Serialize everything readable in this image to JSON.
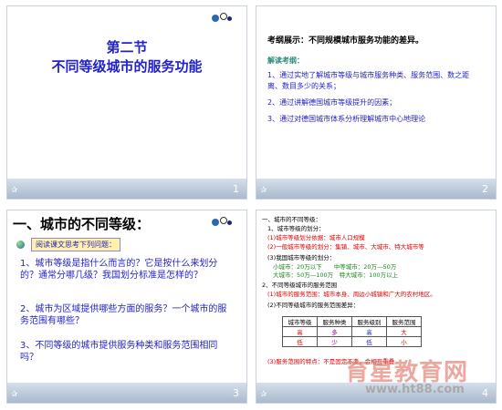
{
  "slides": [
    {
      "number": "1",
      "title_line1": "第二节",
      "title_line2": "不同等级城市的服务功能"
    },
    {
      "number": "2",
      "main": "考纲展示：不同规模城市服务功能的差异。",
      "subhead": "解读考纲：",
      "items": [
        "1、通过实地了解城市等级与城市服务种类、服务范围、数之距离、数目多少的关系；",
        "2、通过讲解德国城市等级提升的因素；",
        "3、通过对德国城市体系分析理解城市中心地理论"
      ]
    },
    {
      "number": "3",
      "heading": "一、城市的不同等级：",
      "note": "阅读课文思考下列问题：",
      "questions": [
        "1、城市等级是指什么而言的？它是按什么来划分的？通常分哪几级？我国划分标准是怎样的？",
        "2、城市为区域提供哪些方面的服务？一个城市的服务范围有哪些？",
        "3、不同等级的城市提供服务种类和服务范围相同吗？"
      ]
    },
    {
      "number": "4",
      "lines": [
        "一、城市的不同等级：",
        "1、城市等级的划分：",
        "(1)城市等级划分依据：城市人口规模",
        "(2)一般城市等级的划分：集镇、城市、大城市、特大城市等",
        "(3)我国城市等级的划分：",
        "小城市：20万以下　　中等城市：20万—50万",
        "大城市：50万—100万　特大城市：100万以上",
        "2、不同等级城市的服务范围",
        "(1)城市的服务范围：城市本身、周边小城镇和广大的农村地区。",
        "(2)不同等级城市的服务范围差异：",
        "(3)服务范围的特点：不是固定不变，会相互重叠。"
      ],
      "table_headers": [
        "城市等级",
        "服务种类",
        "服务级别",
        "服务范围"
      ],
      "table_rows": [
        [
          "高",
          "多",
          "高",
          "大"
        ],
        [
          "低",
          "少",
          "低",
          "小"
        ]
      ]
    }
  ],
  "watermark": {
    "brand": "育星教育网",
    "url": "www.ht88.com"
  }
}
